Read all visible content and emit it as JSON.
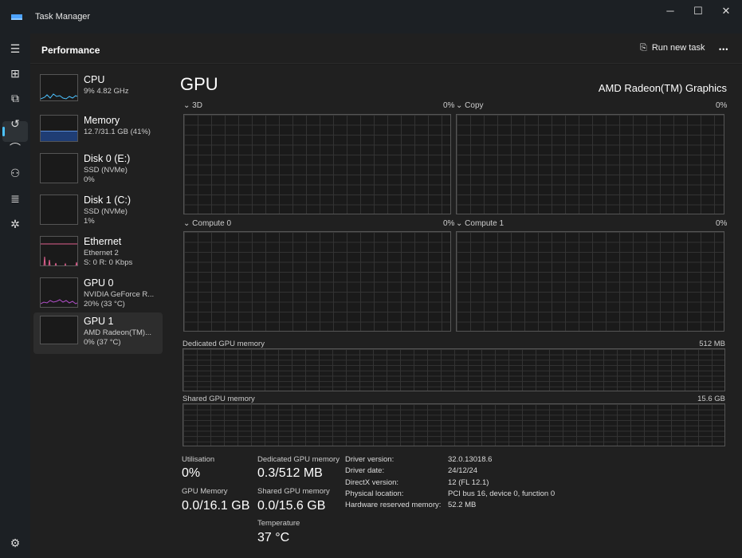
{
  "window": {
    "title": "Task Manager",
    "minimize": "─",
    "maximize": "☐",
    "close": "✕"
  },
  "header": {
    "title": "Performance",
    "run_new_task": "Run new task",
    "more": "•••"
  },
  "nav": [
    "hamburger",
    "processes",
    "performance",
    "app-history",
    "startup",
    "users",
    "details",
    "services",
    "settings"
  ],
  "devices": [
    {
      "name": "CPU",
      "line1": "9% 4.82 GHz",
      "line2": "",
      "color": "#4cc2ff"
    },
    {
      "name": "Memory",
      "line1": "12.7/31.1 GB (41%)",
      "line2": "",
      "color": "#5b8dd6"
    },
    {
      "name": "Disk 0 (E:)",
      "line1": "SSD (NVMe)",
      "line2": "0%",
      "color": "#8ad15f"
    },
    {
      "name": "Disk 1 (C:)",
      "line1": "SSD (NVMe)",
      "line2": "1%",
      "color": "#8ad15f"
    },
    {
      "name": "Ethernet",
      "line1": "Ethernet 2",
      "line2": "S: 0 R: 0 Kbps",
      "color": "#e0608f"
    },
    {
      "name": "GPU 0",
      "line1": "NVIDIA GeForce R...",
      "line2": "20% (33 °C)",
      "color": "#b04fc8"
    },
    {
      "name": "GPU 1",
      "line1": "AMD Radeon(TM)...",
      "line2": "0% (37 °C)",
      "color": "#b04fc8"
    }
  ],
  "main": {
    "title": "GPU",
    "device": "AMD Radeon(TM) Graphics",
    "engines": [
      {
        "name": "3D",
        "pct": "0%"
      },
      {
        "name": "Copy",
        "pct": "0%"
      },
      {
        "name": "Compute 0",
        "pct": "0%"
      },
      {
        "name": "Compute 1",
        "pct": "0%"
      }
    ],
    "dedicated": {
      "label": "Dedicated GPU memory",
      "max": "512 MB"
    },
    "shared": {
      "label": "Shared GPU memory",
      "max": "15.6 GB"
    },
    "stats": {
      "util_label": "Utilisation",
      "util": "0%",
      "gpumem_label": "GPU Memory",
      "gpumem": "0.0/16.1 GB",
      "ded_label": "Dedicated GPU memory",
      "ded": "0.3/512 MB",
      "sh_label": "Shared GPU memory",
      "sh": "0.0/15.6 GB",
      "temp_label": "Temperature",
      "temp": "37 °C"
    },
    "info": [
      {
        "k": "Driver version:",
        "v": "32.0.13018.6"
      },
      {
        "k": "Driver date:",
        "v": "24/12/24"
      },
      {
        "k": "DirectX version:",
        "v": "12 (FL 12.1)"
      },
      {
        "k": "Physical location:",
        "v": "PCI bus 16, device 0, function 0"
      },
      {
        "k": "Hardware reserved memory:",
        "v": "52.2 MB"
      }
    ]
  }
}
